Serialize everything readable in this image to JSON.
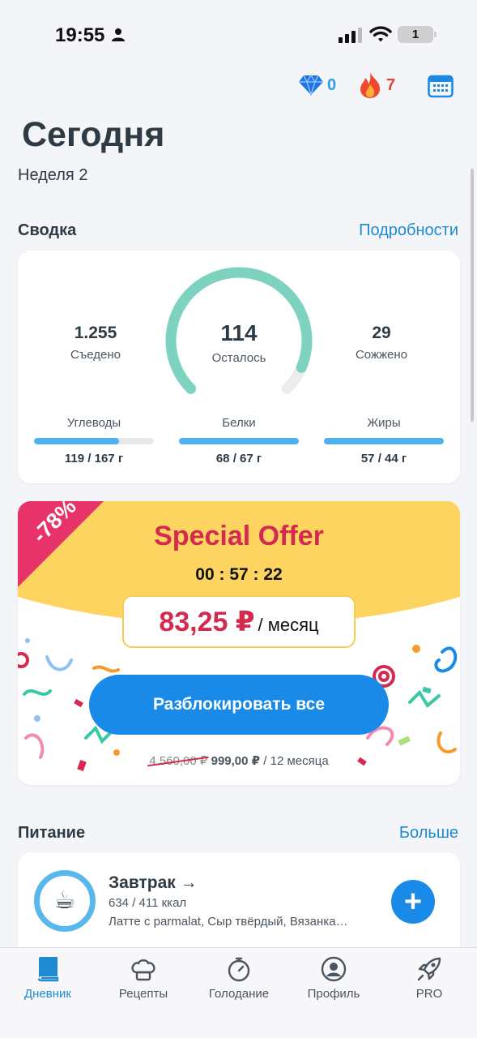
{
  "status_bar": {
    "time": "19:55",
    "battery": "1"
  },
  "header": {
    "gems": "0",
    "streak": "7",
    "title": "Сегодня",
    "week": "Неделя 2"
  },
  "summary": {
    "section_title": "Сводка",
    "details_link": "Подробности",
    "eaten_value": "1.255",
    "eaten_label": "Съедено",
    "left_value": "114",
    "left_label": "Осталось",
    "burned_value": "29",
    "burned_label": "Сожжено",
    "gauge_progress": 0.92,
    "macros": [
      {
        "label": "Углеводы",
        "value": "119 / 167 г",
        "progress": 0.71
      },
      {
        "label": "Белки",
        "value": "68 / 67 г",
        "progress": 1.0
      },
      {
        "label": "Жиры",
        "value": "57 / 44 г",
        "progress": 1.0
      }
    ]
  },
  "offer": {
    "discount": "-78%",
    "title": "Special Offer",
    "timer": "00 : 57 : 22",
    "price": "83,25 ₽",
    "period": "/ месяц",
    "button": "Разблокировать все",
    "old_price": "4 560,00 ₽",
    "new_price": "999,00 ₽",
    "term": "/ 12 месяца"
  },
  "nutrition": {
    "section_title": "Питание",
    "more_link": "Больше",
    "meal": {
      "title": "Завтрак →",
      "kcal": "634 / 411 ккал",
      "items": "Латте с parmalat, Сыр твёрдый, Вязанка…"
    }
  },
  "nav": [
    {
      "label": "Дневник"
    },
    {
      "label": "Рецепты"
    },
    {
      "label": "Голодание"
    },
    {
      "label": "Профиль"
    },
    {
      "label": "PRO"
    }
  ],
  "colors": {
    "accent": "#1a8ae8",
    "gauge": "#7dd3c0",
    "offer_yellow": "#fcd45f",
    "offer_red": "#d42a4f"
  }
}
